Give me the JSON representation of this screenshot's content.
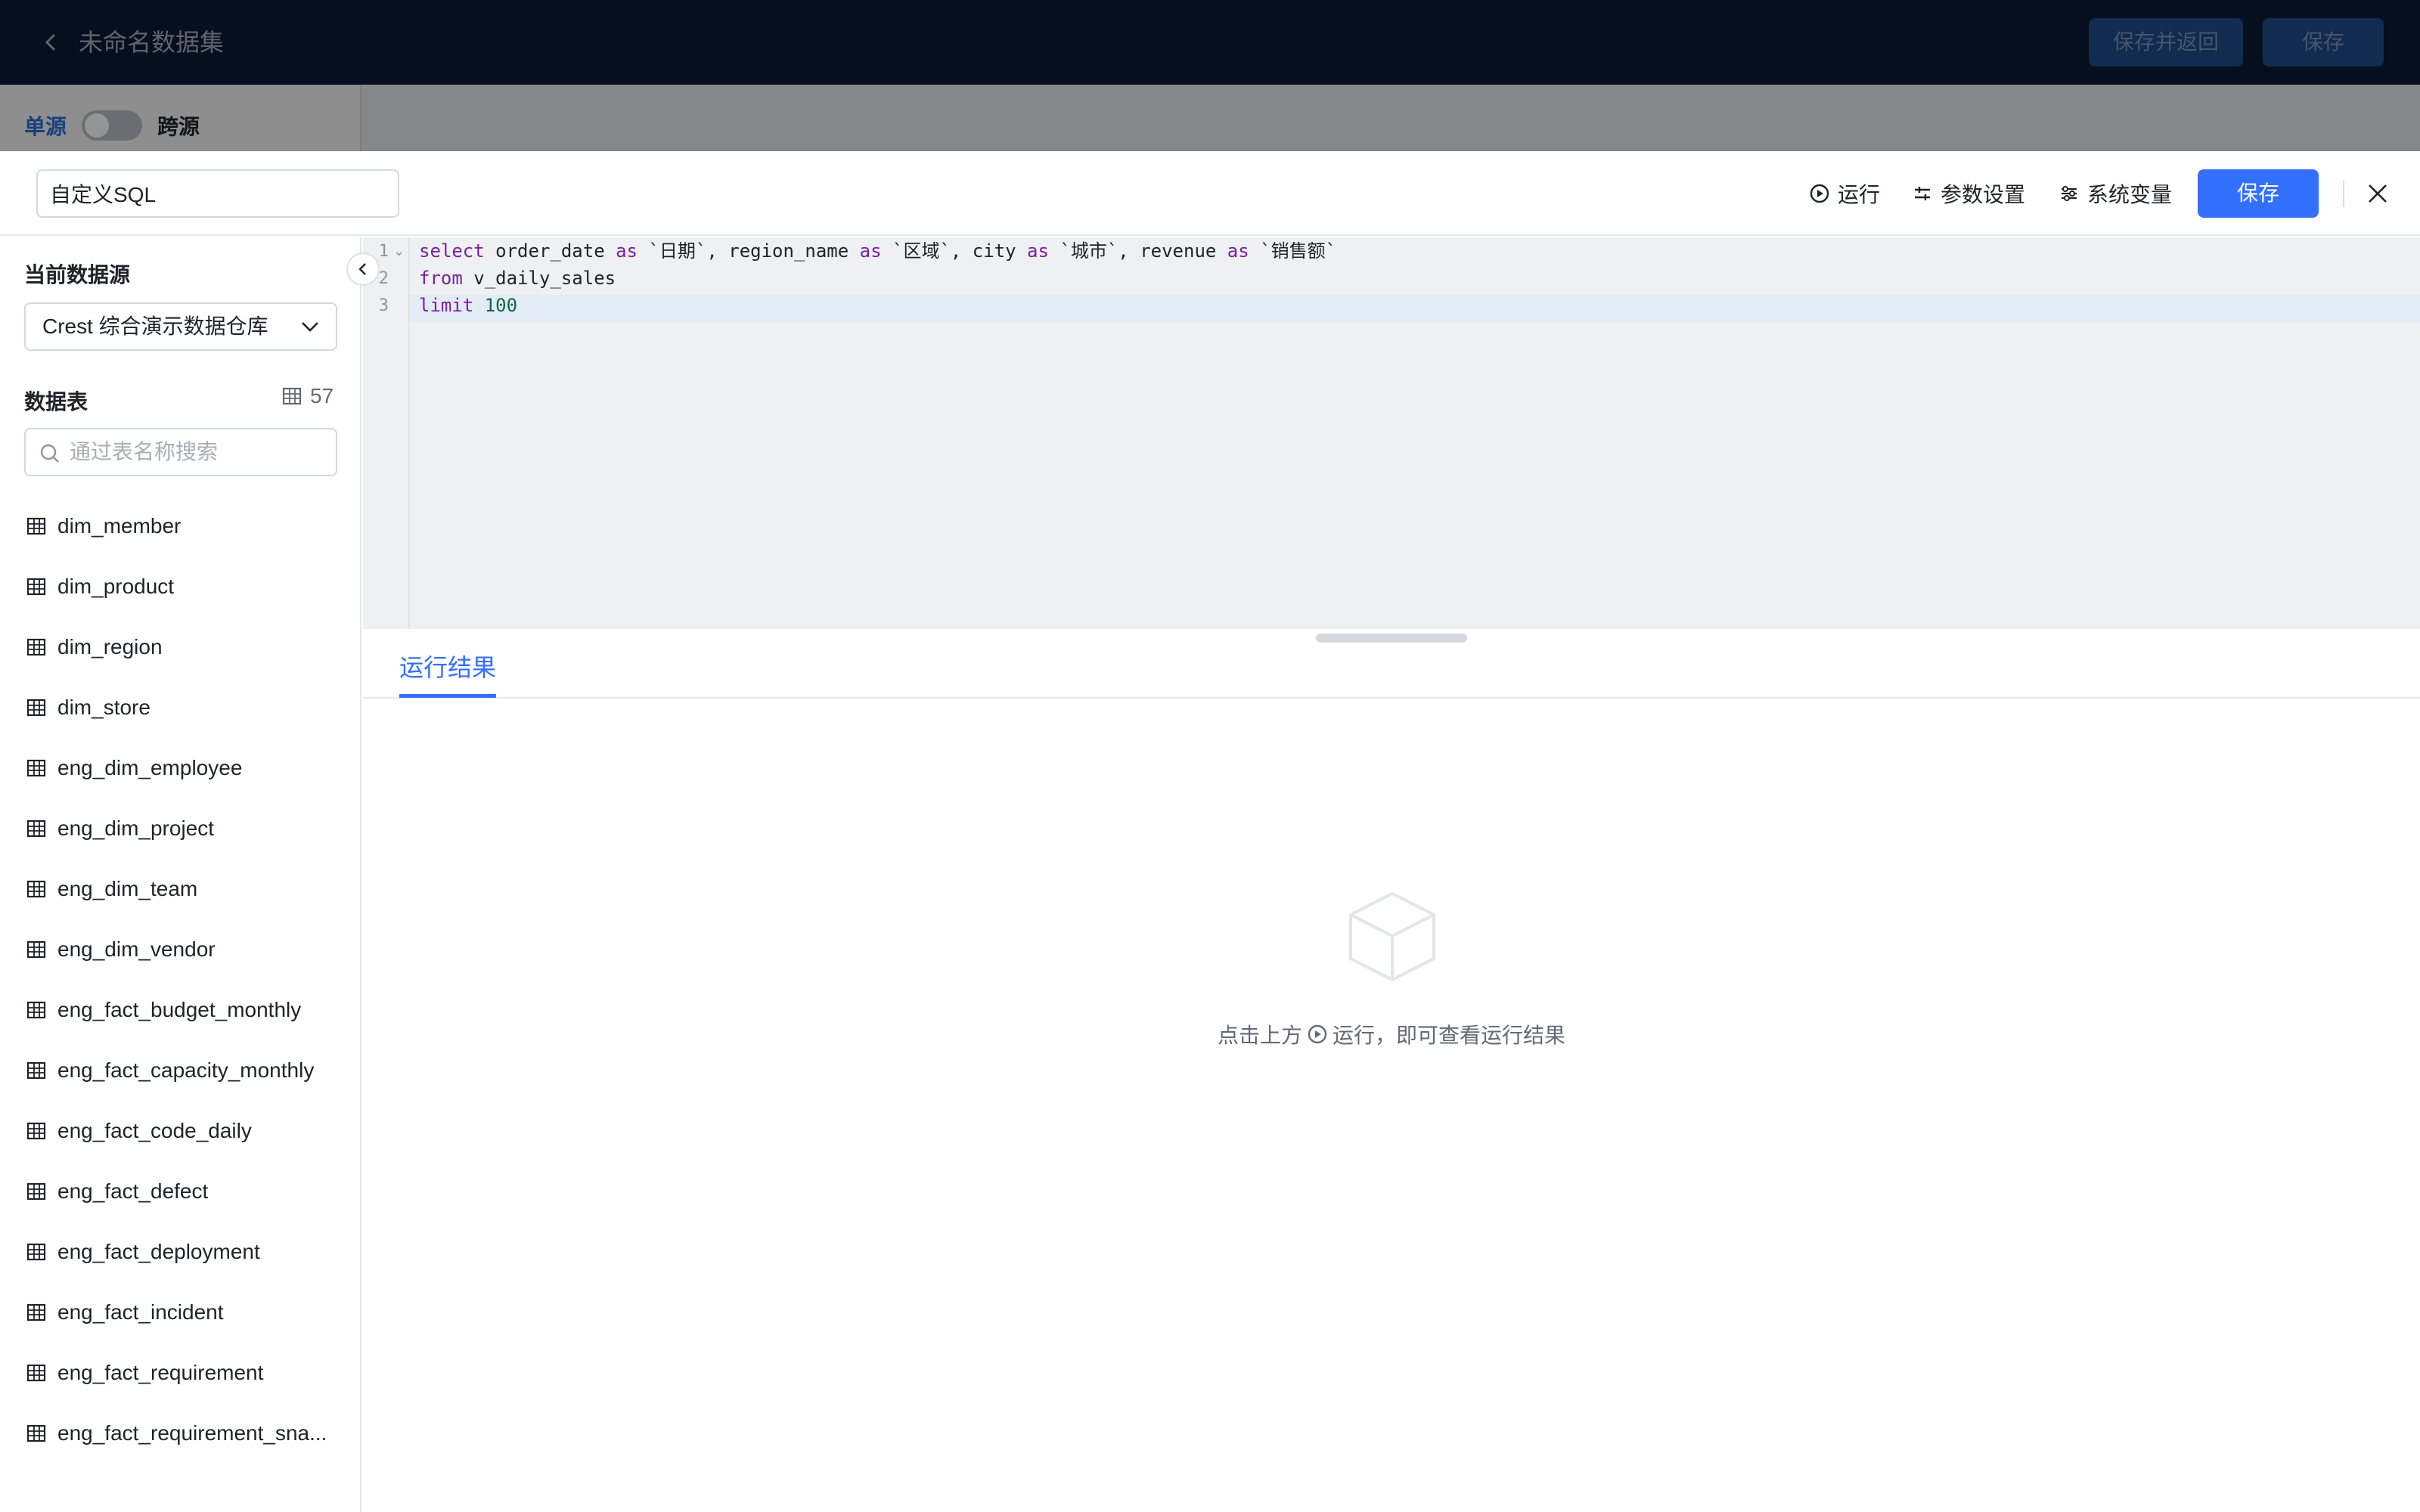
{
  "topbar": {
    "title": "未命名数据集",
    "save_return_label": "保存并返回",
    "save_label": "保存"
  },
  "subbar": {
    "single_source_label": "单源",
    "cross_source_label": "跨源"
  },
  "drawer": {
    "name_value": "自定义SQL",
    "actions": {
      "run_label": "运行",
      "params_label": "参数设置",
      "sysvar_label": "系统变量"
    },
    "save_label": "保存"
  },
  "sidebar": {
    "current_datasource_label": "当前数据源",
    "datasource_value": "Crest 综合演示数据仓库",
    "tables_label": "数据表",
    "table_count": "57",
    "search_placeholder": "通过表名称搜索",
    "tables": [
      "dim_member",
      "dim_product",
      "dim_region",
      "dim_store",
      "eng_dim_employee",
      "eng_dim_project",
      "eng_dim_team",
      "eng_dim_vendor",
      "eng_fact_budget_monthly",
      "eng_fact_capacity_monthly",
      "eng_fact_code_daily",
      "eng_fact_defect",
      "eng_fact_deployment",
      "eng_fact_incident",
      "eng_fact_requirement",
      "eng_fact_requirement_sna..."
    ]
  },
  "editor": {
    "line_numbers": [
      "1",
      "2",
      "3"
    ],
    "lines": [
      [
        [
          "kw",
          "select"
        ],
        [
          "t",
          " order_date "
        ],
        [
          "kw",
          "as"
        ],
        [
          "t",
          " `日期`, region_name "
        ],
        [
          "kw",
          "as"
        ],
        [
          "t",
          " `区域`, city "
        ],
        [
          "kw",
          "as"
        ],
        [
          "t",
          " `城市`, revenue "
        ],
        [
          "kw",
          "as"
        ],
        [
          "t",
          " `销售额`"
        ]
      ],
      [
        [
          "kw",
          "from"
        ],
        [
          "t",
          " v_daily_sales"
        ]
      ],
      [
        [
          "kw",
          "limit"
        ],
        [
          "t",
          " "
        ],
        [
          "num",
          "100"
        ]
      ]
    ]
  },
  "results": {
    "tab_label": "运行结果",
    "empty_prefix": "点击上方",
    "empty_suffix": "运行，即可查看运行结果"
  },
  "colors": {
    "accent": "#3370ff",
    "topbar_bg": "#0b1a33",
    "keyword": "#7a1fa2",
    "number": "#116644"
  }
}
